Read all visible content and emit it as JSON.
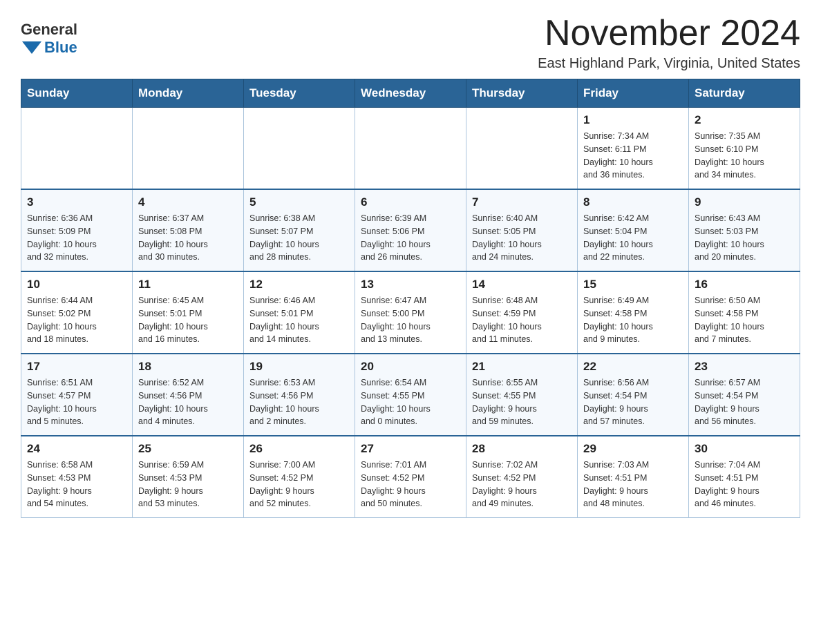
{
  "logo": {
    "general": "General",
    "blue": "Blue"
  },
  "title": "November 2024",
  "location": "East Highland Park, Virginia, United States",
  "weekdays": [
    "Sunday",
    "Monday",
    "Tuesday",
    "Wednesday",
    "Thursday",
    "Friday",
    "Saturday"
  ],
  "weeks": [
    [
      {
        "day": "",
        "info": ""
      },
      {
        "day": "",
        "info": ""
      },
      {
        "day": "",
        "info": ""
      },
      {
        "day": "",
        "info": ""
      },
      {
        "day": "",
        "info": ""
      },
      {
        "day": "1",
        "info": "Sunrise: 7:34 AM\nSunset: 6:11 PM\nDaylight: 10 hours\nand 36 minutes."
      },
      {
        "day": "2",
        "info": "Sunrise: 7:35 AM\nSunset: 6:10 PM\nDaylight: 10 hours\nand 34 minutes."
      }
    ],
    [
      {
        "day": "3",
        "info": "Sunrise: 6:36 AM\nSunset: 5:09 PM\nDaylight: 10 hours\nand 32 minutes."
      },
      {
        "day": "4",
        "info": "Sunrise: 6:37 AM\nSunset: 5:08 PM\nDaylight: 10 hours\nand 30 minutes."
      },
      {
        "day": "5",
        "info": "Sunrise: 6:38 AM\nSunset: 5:07 PM\nDaylight: 10 hours\nand 28 minutes."
      },
      {
        "day": "6",
        "info": "Sunrise: 6:39 AM\nSunset: 5:06 PM\nDaylight: 10 hours\nand 26 minutes."
      },
      {
        "day": "7",
        "info": "Sunrise: 6:40 AM\nSunset: 5:05 PM\nDaylight: 10 hours\nand 24 minutes."
      },
      {
        "day": "8",
        "info": "Sunrise: 6:42 AM\nSunset: 5:04 PM\nDaylight: 10 hours\nand 22 minutes."
      },
      {
        "day": "9",
        "info": "Sunrise: 6:43 AM\nSunset: 5:03 PM\nDaylight: 10 hours\nand 20 minutes."
      }
    ],
    [
      {
        "day": "10",
        "info": "Sunrise: 6:44 AM\nSunset: 5:02 PM\nDaylight: 10 hours\nand 18 minutes."
      },
      {
        "day": "11",
        "info": "Sunrise: 6:45 AM\nSunset: 5:01 PM\nDaylight: 10 hours\nand 16 minutes."
      },
      {
        "day": "12",
        "info": "Sunrise: 6:46 AM\nSunset: 5:01 PM\nDaylight: 10 hours\nand 14 minutes."
      },
      {
        "day": "13",
        "info": "Sunrise: 6:47 AM\nSunset: 5:00 PM\nDaylight: 10 hours\nand 13 minutes."
      },
      {
        "day": "14",
        "info": "Sunrise: 6:48 AM\nSunset: 4:59 PM\nDaylight: 10 hours\nand 11 minutes."
      },
      {
        "day": "15",
        "info": "Sunrise: 6:49 AM\nSunset: 4:58 PM\nDaylight: 10 hours\nand 9 minutes."
      },
      {
        "day": "16",
        "info": "Sunrise: 6:50 AM\nSunset: 4:58 PM\nDaylight: 10 hours\nand 7 minutes."
      }
    ],
    [
      {
        "day": "17",
        "info": "Sunrise: 6:51 AM\nSunset: 4:57 PM\nDaylight: 10 hours\nand 5 minutes."
      },
      {
        "day": "18",
        "info": "Sunrise: 6:52 AM\nSunset: 4:56 PM\nDaylight: 10 hours\nand 4 minutes."
      },
      {
        "day": "19",
        "info": "Sunrise: 6:53 AM\nSunset: 4:56 PM\nDaylight: 10 hours\nand 2 minutes."
      },
      {
        "day": "20",
        "info": "Sunrise: 6:54 AM\nSunset: 4:55 PM\nDaylight: 10 hours\nand 0 minutes."
      },
      {
        "day": "21",
        "info": "Sunrise: 6:55 AM\nSunset: 4:55 PM\nDaylight: 9 hours\nand 59 minutes."
      },
      {
        "day": "22",
        "info": "Sunrise: 6:56 AM\nSunset: 4:54 PM\nDaylight: 9 hours\nand 57 minutes."
      },
      {
        "day": "23",
        "info": "Sunrise: 6:57 AM\nSunset: 4:54 PM\nDaylight: 9 hours\nand 56 minutes."
      }
    ],
    [
      {
        "day": "24",
        "info": "Sunrise: 6:58 AM\nSunset: 4:53 PM\nDaylight: 9 hours\nand 54 minutes."
      },
      {
        "day": "25",
        "info": "Sunrise: 6:59 AM\nSunset: 4:53 PM\nDaylight: 9 hours\nand 53 minutes."
      },
      {
        "day": "26",
        "info": "Sunrise: 7:00 AM\nSunset: 4:52 PM\nDaylight: 9 hours\nand 52 minutes."
      },
      {
        "day": "27",
        "info": "Sunrise: 7:01 AM\nSunset: 4:52 PM\nDaylight: 9 hours\nand 50 minutes."
      },
      {
        "day": "28",
        "info": "Sunrise: 7:02 AM\nSunset: 4:52 PM\nDaylight: 9 hours\nand 49 minutes."
      },
      {
        "day": "29",
        "info": "Sunrise: 7:03 AM\nSunset: 4:51 PM\nDaylight: 9 hours\nand 48 minutes."
      },
      {
        "day": "30",
        "info": "Sunrise: 7:04 AM\nSunset: 4:51 PM\nDaylight: 9 hours\nand 46 minutes."
      }
    ]
  ]
}
